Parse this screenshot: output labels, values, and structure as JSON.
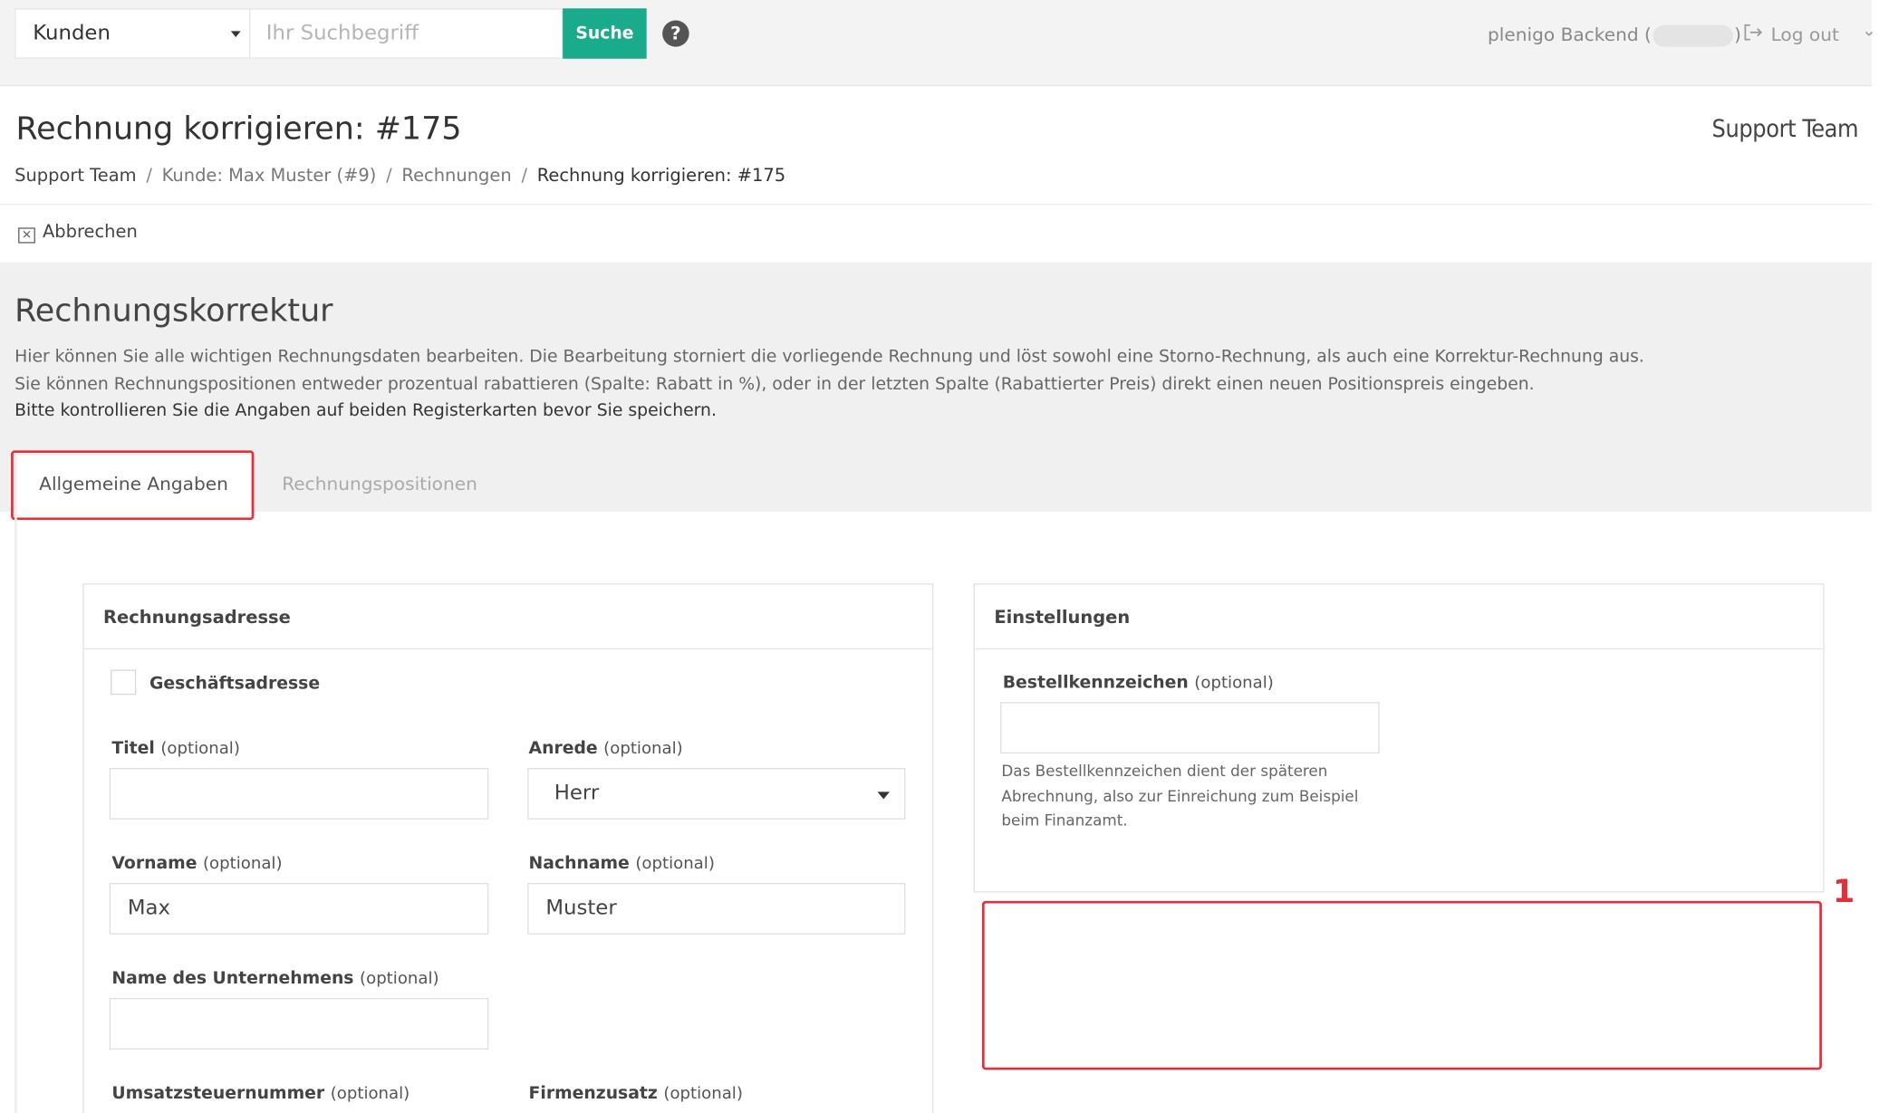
{
  "topbar": {
    "search_category": "Kunden",
    "search_placeholder": "Ihr Suchbegriff",
    "search_button": "Suche",
    "help_icon": "question-circle-icon",
    "user_prefix": "plenigo Backend (",
    "user_suffix": ")",
    "logout_label": "Log out",
    "logout_icon": "sign-out-icon"
  },
  "header": {
    "title": "Rechnung korrigieren: #175",
    "team": "Support Team",
    "breadcrumb": [
      "Support Team",
      "Kunde: Max Muster (#9)",
      "Rechnungen",
      "Rechnung korrigieren: #175"
    ],
    "breadcrumb_sep": "/",
    "cancel_label": "Abbrechen",
    "cancel_icon": "close-square-icon"
  },
  "section": {
    "title": "Rechnungskorrektur",
    "desc_line1": "Hier können Sie alle wichtigen Rechnungsdaten bearbeiten. Die Bearbeitung storniert die vorliegende Rechnung und löst sowohl eine Storno-Rechnung, als auch eine Korrektur-Rechnung aus.",
    "desc_line2": "Sie können Rechnungspositionen entweder prozentual rabattieren (Spalte: Rabatt in %), oder in der letzten Spalte (Rabattierter Preis) direkt einen neuen Positionspreis eingeben.",
    "desc_line3": "Bitte kontrollieren Sie die Angaben auf beiden Registerkarten bevor Sie speichern."
  },
  "tabs": [
    {
      "label": "Allgemeine Angaben",
      "active": true
    },
    {
      "label": "Rechnungspositionen",
      "active": false
    }
  ],
  "billing": {
    "heading": "Rechnungsadresse",
    "business_checkbox_label": "Geschäftsadresse",
    "optional": "(optional)",
    "titel_label": "Titel",
    "titel_value": "",
    "anrede_label": "Anrede",
    "anrede_value": "Herr",
    "vorname_label": "Vorname",
    "vorname_value": "Max",
    "nachname_label": "Nachname",
    "nachname_value": "Muster",
    "company_label": "Name des Unternehmens",
    "company_value": "",
    "vat_label": "Umsatzsteuernummer",
    "suffix_label": "Firmenzusatz"
  },
  "settings": {
    "heading": "Einstellungen",
    "order_label": "Bestellkennzeichen",
    "optional": "(optional)",
    "order_value": "",
    "order_help": "Das Bestellkennzeichen dient der späteren Abrechnung, also zur Einreichung zum Beispiel beim Finanzamt."
  },
  "annotation": {
    "number": "1",
    "color": "#e0303b"
  },
  "colors": {
    "accent": "#1aaa8c",
    "highlight": "#e0303b"
  }
}
